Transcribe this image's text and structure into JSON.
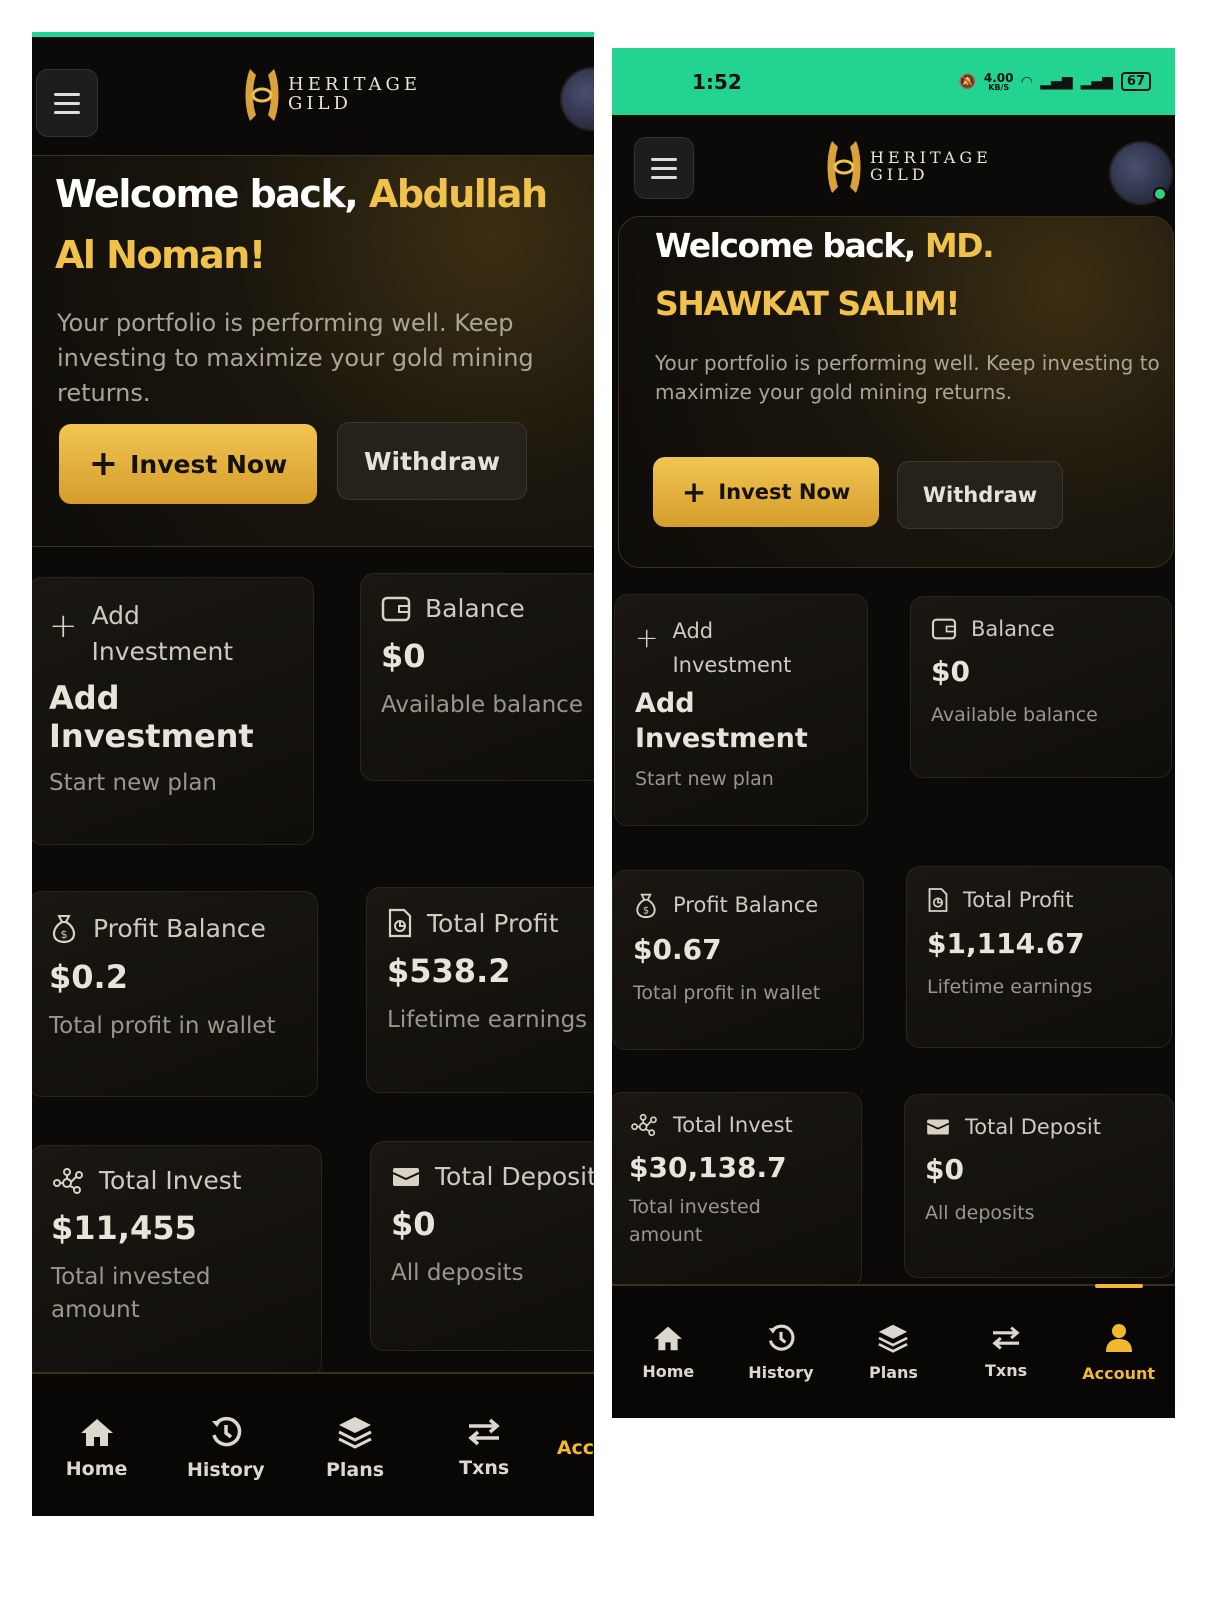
{
  "brand": {
    "line1": "HERITAGE",
    "line2": "GILD"
  },
  "left": {
    "welcome": {
      "prefix": "Welcome back, ",
      "name": "Abdullah Al Noman!",
      "message": "Your portfolio is performing well. Keep investing to maximize your gold mining returns."
    },
    "buttons": {
      "invest": "Invest Now",
      "withdraw": "Withdraw"
    },
    "cards": {
      "add": {
        "label": "Add Investment",
        "title": "Add Investment",
        "sub": "Start new plan"
      },
      "balance": {
        "label": "Balance",
        "value": "$0",
        "sub": "Available balance"
      },
      "profit_balance": {
        "label": "Profit Balance",
        "value": "$0.2",
        "sub": "Total profit in wallet"
      },
      "total_profit": {
        "label": "Total Profit",
        "value": "$538.2",
        "sub": "Lifetime earnings"
      },
      "total_invest": {
        "label": "Total Invest",
        "value": "$11,455",
        "sub": "Total invested amount"
      },
      "total_deposit": {
        "label": "Total Deposit",
        "value": "$0",
        "sub": "All deposits"
      }
    },
    "nav": [
      "Home",
      "History",
      "Plans",
      "Txns",
      "Account"
    ]
  },
  "right": {
    "status": {
      "time": "1:52",
      "speed": "4.00",
      "speed_unit": "KB/S",
      "battery": "67"
    },
    "welcome": {
      "prefix": "Welcome back, ",
      "name": "MD. SHAWKAT SALIM!",
      "message": "Your portfolio is performing well. Keep investing to maximize your gold mining returns."
    },
    "buttons": {
      "invest": "Invest Now",
      "withdraw": "Withdraw"
    },
    "cards": {
      "add": {
        "label": "Add Investment",
        "title": "Add Investment",
        "sub": "Start new plan"
      },
      "balance": {
        "label": "Balance",
        "value": "$0",
        "sub": "Available balance"
      },
      "profit_balance": {
        "label": "Profit Balance",
        "value": "$0.67",
        "sub": "Total profit in wallet"
      },
      "total_profit": {
        "label": "Total Profit",
        "value": "$1,114.67",
        "sub": "Lifetime earnings"
      },
      "total_invest": {
        "label": "Total Invest",
        "value": "$30,138.7",
        "sub": "Total invested amount"
      },
      "total_deposit": {
        "label": "Total Deposit",
        "value": "$0",
        "sub": "All deposits"
      }
    },
    "nav": [
      "Home",
      "History",
      "Plans",
      "Txns",
      "Account"
    ],
    "nav_active": "Account"
  },
  "colors": {
    "accent": "#f0c24b",
    "status_bar": "#22d48f",
    "background": "#0b0a08"
  }
}
